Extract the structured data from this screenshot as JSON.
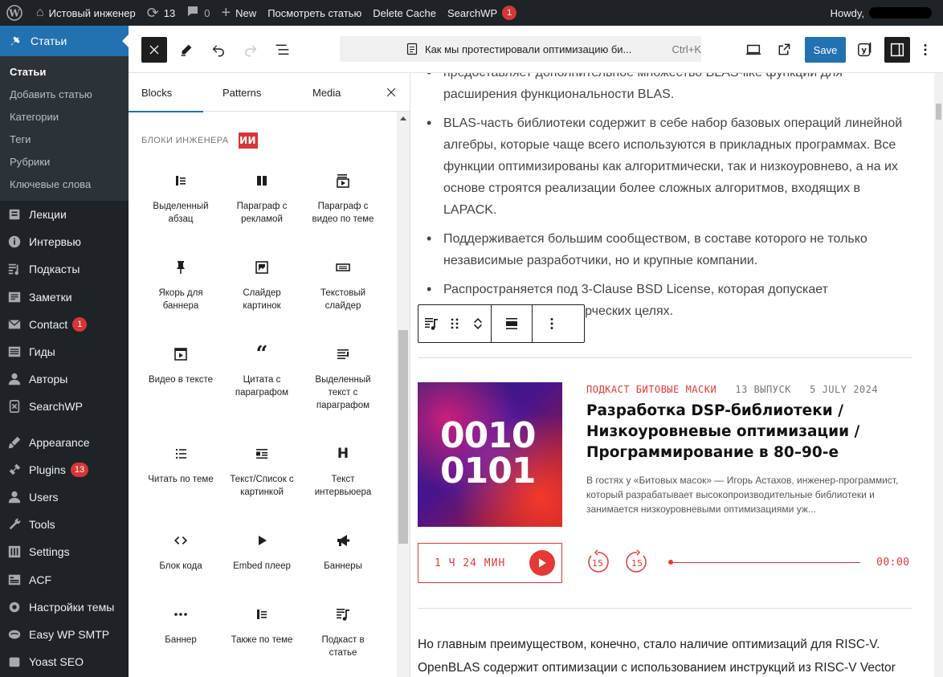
{
  "adminbar": {
    "site_name": "Истовый инженер",
    "updates_count": "13",
    "comments_count": "0",
    "new_label": "New",
    "view_post": "Посмотреть статью",
    "delete_cache": "Delete Cache",
    "searchwp": "SearchWP",
    "searchwp_badge": "1",
    "howdy": "Howdy,"
  },
  "sidebar": {
    "current": "Статьи",
    "submenu": [
      "Статьи",
      "Добавить статью",
      "Категории",
      "Теги",
      "Рубрики",
      "Ключевые слова"
    ],
    "items": [
      {
        "label": "Лекции",
        "icon": "lectures-icon"
      },
      {
        "label": "Интервью",
        "icon": "interview-icon"
      },
      {
        "label": "Подкасты",
        "icon": "podcasts-icon"
      },
      {
        "label": "Заметки",
        "icon": "notes-icon"
      },
      {
        "label": "Contact",
        "icon": "mail-icon",
        "badge": "1"
      },
      {
        "label": "Гиды",
        "icon": "guides-icon"
      },
      {
        "label": "Авторы",
        "icon": "authors-icon"
      },
      {
        "label": "SearchWP",
        "icon": "searchwp-icon"
      },
      {
        "label": "Appearance",
        "icon": "appearance-icon"
      },
      {
        "label": "Plugins",
        "icon": "plugins-icon",
        "badge": "13"
      },
      {
        "label": "Users",
        "icon": "users-icon"
      },
      {
        "label": "Tools",
        "icon": "tools-icon"
      },
      {
        "label": "Settings",
        "icon": "settings-icon"
      },
      {
        "label": "ACF",
        "icon": "acf-icon"
      },
      {
        "label": "Настройки темы",
        "icon": "theme-settings-icon"
      },
      {
        "label": "Easy WP SMTP",
        "icon": "smtp-icon"
      },
      {
        "label": "Yoast SEO",
        "icon": "yoast-icon"
      }
    ]
  },
  "toolbar": {
    "doc_title": "Как мы протестировали оптимизацию би...",
    "shortcut": "Ctrl+K",
    "save_label": "Save"
  },
  "inserter": {
    "tabs": [
      "Blocks",
      "Patterns",
      "Media"
    ],
    "category": "БЛОКИ ИНЖЕНЕРА",
    "brand": "ИИ",
    "blocks": [
      {
        "label": "Выделенный абзац",
        "icon": "highlighted-paragraph-icon"
      },
      {
        "label": "Параграф с рекламой",
        "icon": "paragraph-ad-icon"
      },
      {
        "label": "Параграф с видео по теме",
        "icon": "paragraph-video-icon"
      },
      {
        "label": "Якорь для баннера",
        "icon": "pin-icon"
      },
      {
        "label": "Слайдер картинок",
        "icon": "image-slider-icon"
      },
      {
        "label": "Текстовый слайдер",
        "icon": "text-slider-icon"
      },
      {
        "label": "Видео в тексте",
        "icon": "video-icon"
      },
      {
        "label": "Цитата с параграфом",
        "icon": "quote-icon"
      },
      {
        "label": "Выделенный текст с параграфом",
        "icon": "highlighted-text-icon"
      },
      {
        "label": "Читать по теме",
        "icon": "list-icon"
      },
      {
        "label": "Текст/Список с картинкой",
        "icon": "media-text-icon"
      },
      {
        "label": "Текст интервьюера",
        "icon": "heading-icon"
      },
      {
        "label": "Блок кода",
        "icon": "code-icon"
      },
      {
        "label": "Embed плеер",
        "icon": "play-icon"
      },
      {
        "label": "Баннеры",
        "icon": "megaphone-icon"
      },
      {
        "label": "Баннер",
        "icon": "more-icon"
      },
      {
        "label": "Также по теме",
        "icon": "also-icon"
      },
      {
        "label": "Подкаст в статье",
        "icon": "podcast-block-icon"
      }
    ]
  },
  "content": {
    "bullets": [
      "предоставляет дополнительное множество BLAS-like функций для расширения функциональности BLAS.",
      "BLAS-часть библиотеки содержит в себе набор базовых операций линейной алгебры, которые чаще всего используются в прикладных программах. Все функции оптимизированы как алгоритмически, так и низкоуровнево, а на их основе строятся реализации более сложных алгоритмов, входящих в LAPACK.",
      "Поддерживается большим сообществом, в составе которого не только независимые разработчики, но и крупные компании.",
      "Распространяется под 3-Clause BSD License, которая допускает использование в коммерческих целях."
    ],
    "podcast": {
      "cover_text_line1": "0010",
      "cover_text_line2": "0101",
      "category": "ПОДКАСТ БИТОВЫЕ МАСКИ",
      "episode": "13 ВЫПУСК",
      "date": "5 JULY 2024",
      "title": "Разработка DSP-библиотеки / Низкоуровневые оптимизации / Программирование в 80–90-е",
      "description": "В гостях у «Битовых масок» — Игорь Астахов, инженер-программист, который разрабатывает высокопроизводительные библиотеки и занимается низкоуровневыми оптимизациями уж...",
      "duration": "1 Ч 24 МИН",
      "skip_back": "15",
      "skip_forward": "15",
      "time": "00:00"
    },
    "paragraph": "Но главным преимуществом, конечно, стало наличие оптимизаций для RISC-V. OpenBLAS содержит оптимизации с использованием инструкций из RISC-V Vector"
  },
  "colors": {
    "admin_bg": "#1d2327",
    "accent": "#2271b1",
    "badge": "#d63638",
    "podcast_red": "#e53935"
  }
}
